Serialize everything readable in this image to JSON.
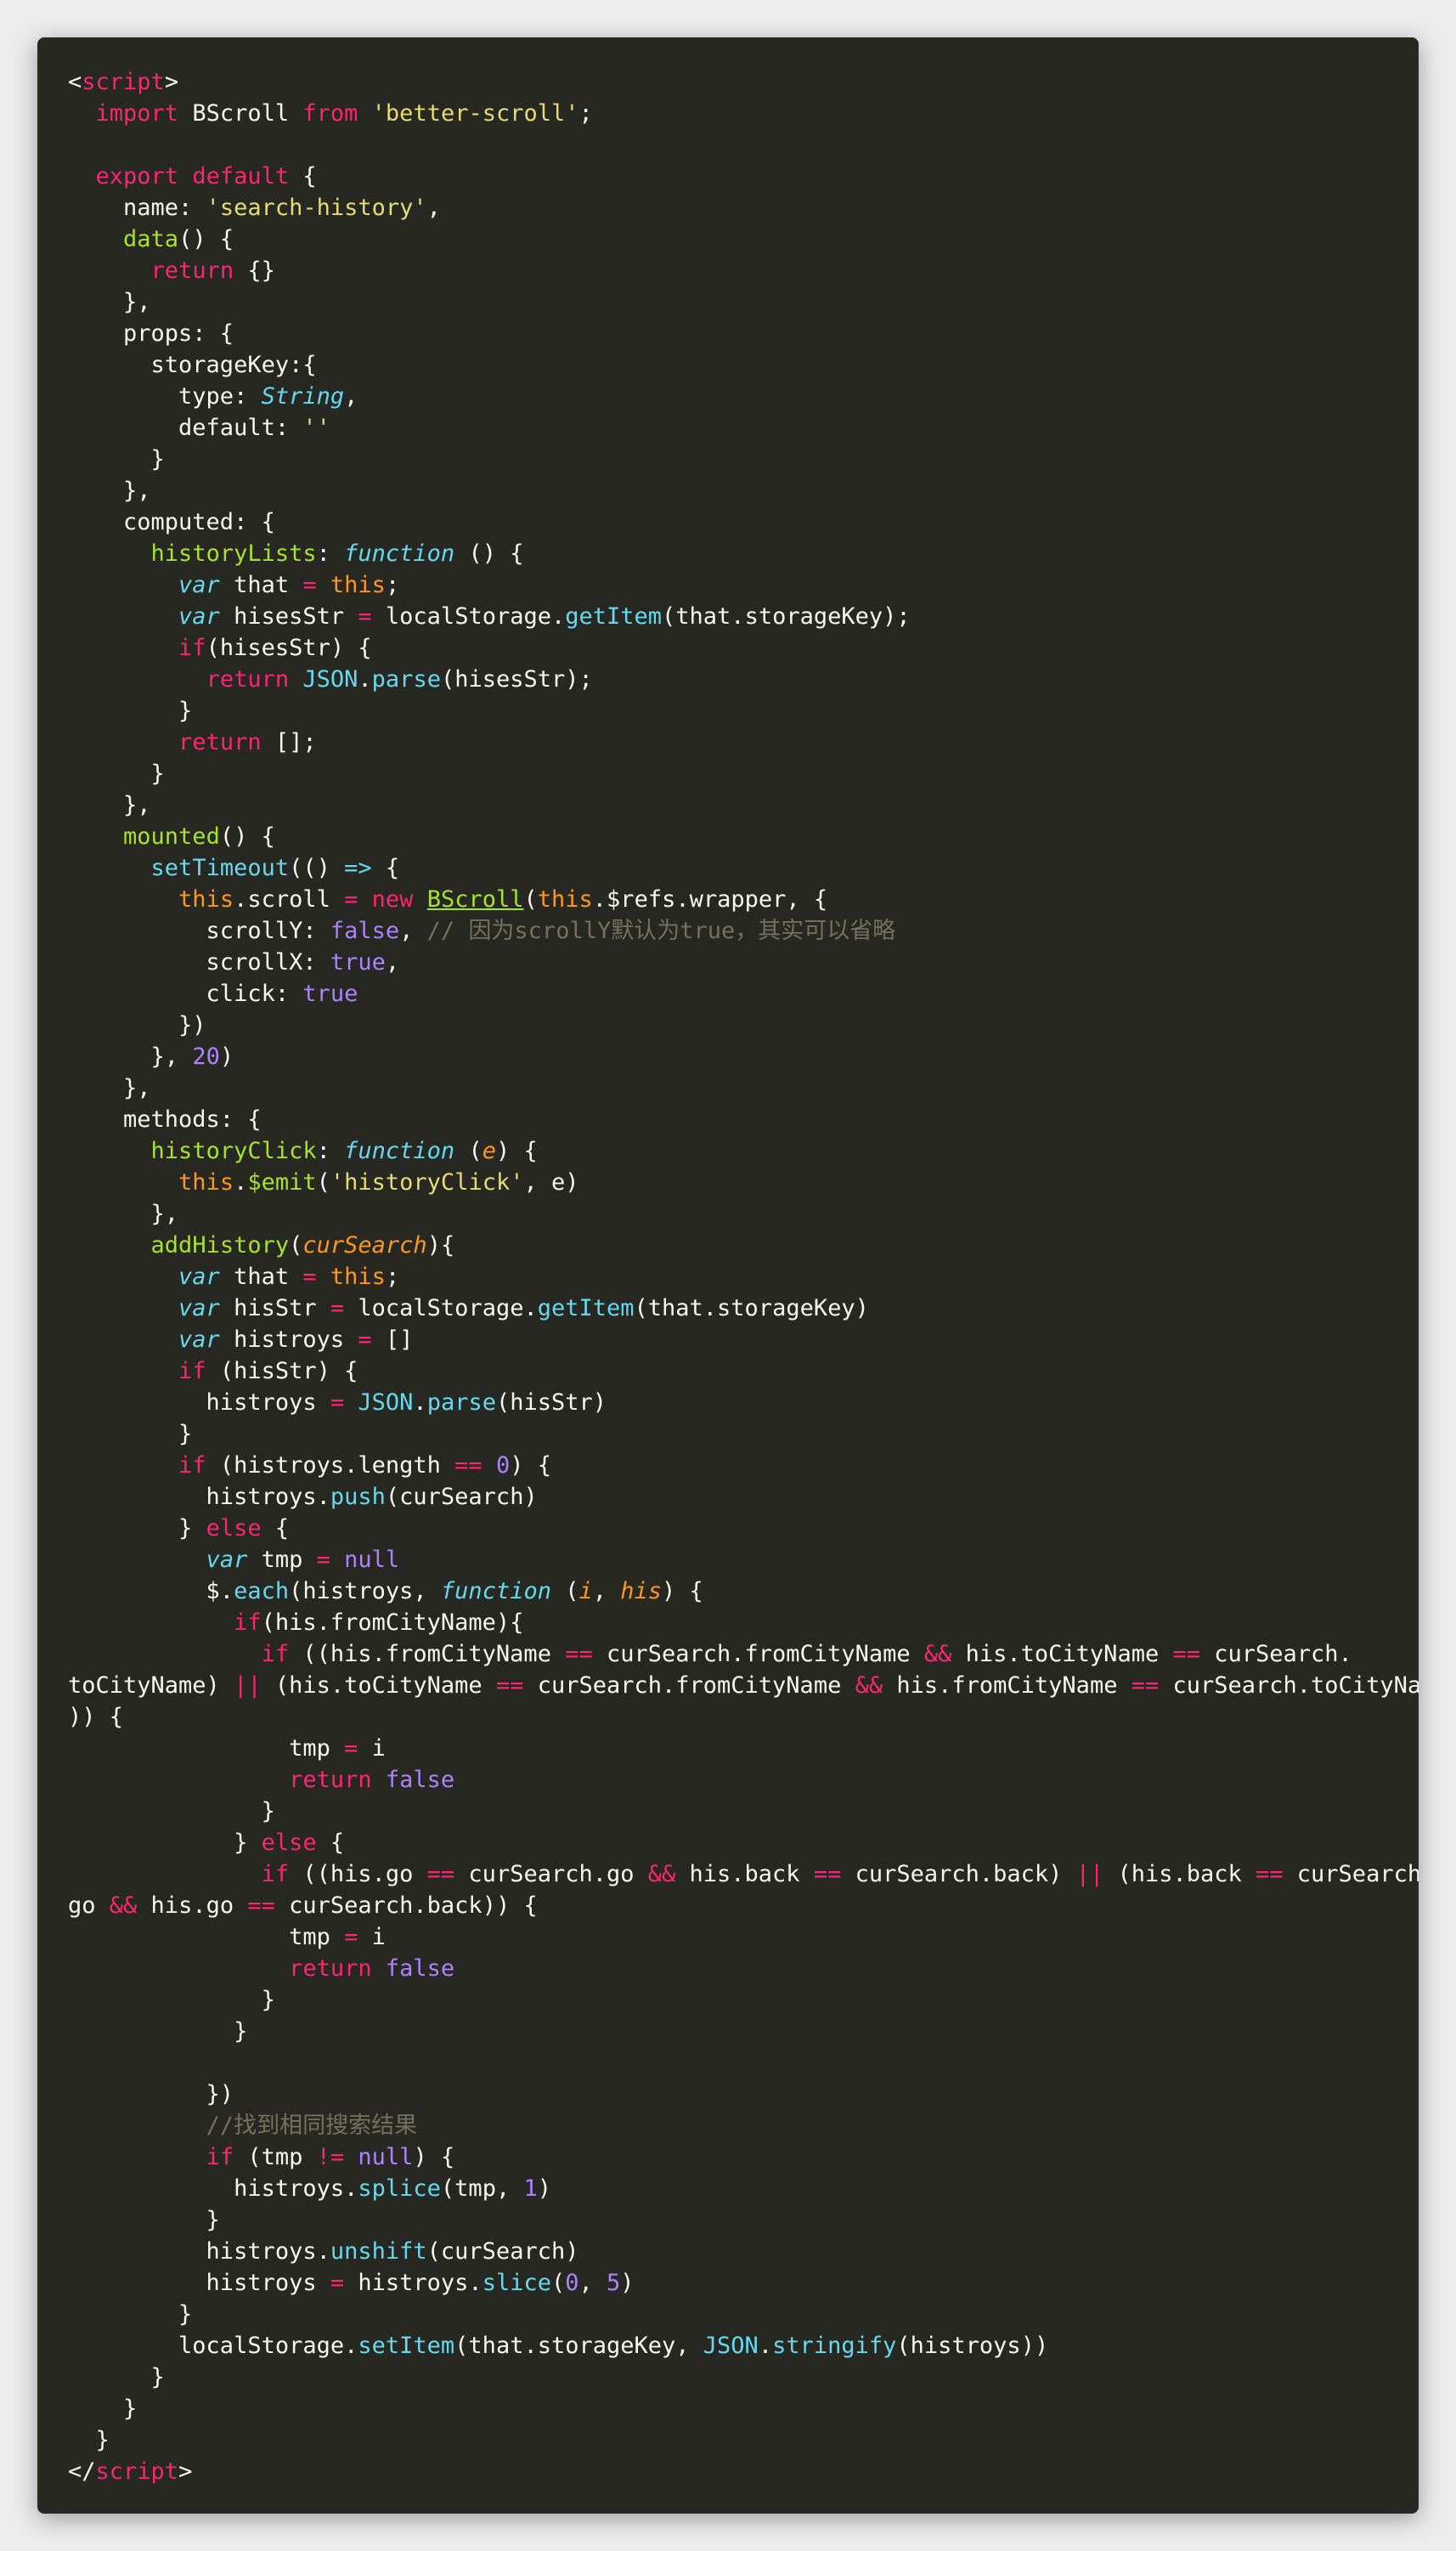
{
  "theme": {
    "background": "#ececec",
    "editor_bg": "#272822",
    "plain": "#f8f8f2",
    "keyword": "#f92672",
    "string": "#e6db74",
    "function": "#a6e22e",
    "builtin": "#66d9ef",
    "number": "#ae81ff",
    "parameter": "#fd971f",
    "comment": "#75715e"
  },
  "code": {
    "language": "vue",
    "lines": [
      [
        [
          "p",
          "<"
        ],
        [
          "k",
          "script"
        ],
        [
          "p",
          ">"
        ]
      ],
      [
        [
          "p",
          "  "
        ],
        [
          "k",
          "import"
        ],
        [
          "p",
          " BScroll "
        ],
        [
          "k",
          "from"
        ],
        [
          "p",
          " "
        ],
        [
          "s",
          "'better-scroll'"
        ],
        [
          "p",
          ";"
        ]
      ],
      [],
      [
        [
          "p",
          "  "
        ],
        [
          "k",
          "export"
        ],
        [
          "p",
          " "
        ],
        [
          "k",
          "default"
        ],
        [
          "p",
          " {"
        ]
      ],
      [
        [
          "p",
          "    name: "
        ],
        [
          "s",
          "'search-history'"
        ],
        [
          "p",
          ","
        ]
      ],
      [
        [
          "p",
          "    "
        ],
        [
          "f",
          "data"
        ],
        [
          "p",
          "() {"
        ]
      ],
      [
        [
          "p",
          "      "
        ],
        [
          "k",
          "return"
        ],
        [
          "p",
          " {}"
        ]
      ],
      [
        [
          "p",
          "    },"
        ]
      ],
      [
        [
          "p",
          "    props: {"
        ]
      ],
      [
        [
          "p",
          "      storageKey:{"
        ]
      ],
      [
        [
          "p",
          "        type: "
        ],
        [
          "i",
          "String"
        ],
        [
          "p",
          ","
        ]
      ],
      [
        [
          "p",
          "        default: "
        ],
        [
          "s",
          "''"
        ]
      ],
      [
        [
          "p",
          "      }"
        ]
      ],
      [
        [
          "p",
          "    },"
        ]
      ],
      [
        [
          "p",
          "    computed: {"
        ]
      ],
      [
        [
          "p",
          "      "
        ],
        [
          "f",
          "historyLists"
        ],
        [
          "p",
          ": "
        ],
        [
          "i",
          "function"
        ],
        [
          "p",
          " () {"
        ]
      ],
      [
        [
          "p",
          "        "
        ],
        [
          "i",
          "var"
        ],
        [
          "p",
          " that "
        ],
        [
          "k",
          "="
        ],
        [
          "p",
          " "
        ],
        [
          "t",
          "this"
        ],
        [
          "p",
          ";"
        ]
      ],
      [
        [
          "p",
          "        "
        ],
        [
          "i",
          "var"
        ],
        [
          "p",
          " hisesStr "
        ],
        [
          "k",
          "="
        ],
        [
          "p",
          " localStorage."
        ],
        [
          "b",
          "getItem"
        ],
        [
          "p",
          "(that.storageKey);"
        ]
      ],
      [
        [
          "p",
          "        "
        ],
        [
          "k",
          "if"
        ],
        [
          "p",
          "(hisesStr) {"
        ]
      ],
      [
        [
          "p",
          "          "
        ],
        [
          "k",
          "return"
        ],
        [
          "p",
          " "
        ],
        [
          "b",
          "JSON"
        ],
        [
          "p",
          "."
        ],
        [
          "b",
          "parse"
        ],
        [
          "p",
          "(hisesStr);"
        ]
      ],
      [
        [
          "p",
          "        }"
        ]
      ],
      [
        [
          "p",
          "        "
        ],
        [
          "k",
          "return"
        ],
        [
          "p",
          " [];"
        ]
      ],
      [
        [
          "p",
          "      }"
        ]
      ],
      [
        [
          "p",
          "    },"
        ]
      ],
      [
        [
          "p",
          "    "
        ],
        [
          "f",
          "mounted"
        ],
        [
          "p",
          "() {"
        ]
      ],
      [
        [
          "p",
          "      "
        ],
        [
          "b",
          "setTimeout"
        ],
        [
          "p",
          "(() "
        ],
        [
          "b",
          "=>"
        ],
        [
          "p",
          " {"
        ]
      ],
      [
        [
          "p",
          "        "
        ],
        [
          "t",
          "this"
        ],
        [
          "p",
          ".scroll "
        ],
        [
          "k",
          "="
        ],
        [
          "p",
          " "
        ],
        [
          "k",
          "new"
        ],
        [
          "p",
          " "
        ],
        [
          "u",
          "BScroll"
        ],
        [
          "p",
          "("
        ],
        [
          "t",
          "this"
        ],
        [
          "p",
          ".$refs.wrapper, {"
        ]
      ],
      [
        [
          "p",
          "          scrollY: "
        ],
        [
          "n",
          "false"
        ],
        [
          "p",
          ", "
        ],
        [
          "c",
          "// 因为scrollY默认为true，其实可以省略"
        ]
      ],
      [
        [
          "p",
          "          scrollX: "
        ],
        [
          "n",
          "true"
        ],
        [
          "p",
          ","
        ]
      ],
      [
        [
          "p",
          "          click: "
        ],
        [
          "n",
          "true"
        ]
      ],
      [
        [
          "p",
          "        })"
        ]
      ],
      [
        [
          "p",
          "      }, "
        ],
        [
          "n",
          "20"
        ],
        [
          "p",
          ")"
        ]
      ],
      [
        [
          "p",
          "    },"
        ]
      ],
      [
        [
          "p",
          "    methods: {"
        ]
      ],
      [
        [
          "p",
          "      "
        ],
        [
          "f",
          "historyClick"
        ],
        [
          "p",
          ": "
        ],
        [
          "i",
          "function"
        ],
        [
          "p",
          " ("
        ],
        [
          "a",
          "e"
        ],
        [
          "p",
          ") {"
        ]
      ],
      [
        [
          "p",
          "        "
        ],
        [
          "t",
          "this"
        ],
        [
          "p",
          "."
        ],
        [
          "f",
          "$emit"
        ],
        [
          "p",
          "("
        ],
        [
          "s",
          "'historyClick'"
        ],
        [
          "p",
          ", e)"
        ]
      ],
      [
        [
          "p",
          "      },"
        ]
      ],
      [
        [
          "p",
          "      "
        ],
        [
          "f",
          "addHistory"
        ],
        [
          "p",
          "("
        ],
        [
          "a",
          "curSearch"
        ],
        [
          "p",
          "){"
        ]
      ],
      [
        [
          "p",
          "        "
        ],
        [
          "i",
          "var"
        ],
        [
          "p",
          " that "
        ],
        [
          "k",
          "="
        ],
        [
          "p",
          " "
        ],
        [
          "t",
          "this"
        ],
        [
          "p",
          ";"
        ]
      ],
      [
        [
          "p",
          "        "
        ],
        [
          "i",
          "var"
        ],
        [
          "p",
          " hisStr "
        ],
        [
          "k",
          "="
        ],
        [
          "p",
          " localStorage."
        ],
        [
          "b",
          "getItem"
        ],
        [
          "p",
          "(that.storageKey)"
        ]
      ],
      [
        [
          "p",
          "        "
        ],
        [
          "i",
          "var"
        ],
        [
          "p",
          " histroys "
        ],
        [
          "k",
          "="
        ],
        [
          "p",
          " []"
        ]
      ],
      [
        [
          "p",
          "        "
        ],
        [
          "k",
          "if"
        ],
        [
          "p",
          " (hisStr) {"
        ]
      ],
      [
        [
          "p",
          "          histroys "
        ],
        [
          "k",
          "="
        ],
        [
          "p",
          " "
        ],
        [
          "b",
          "JSON"
        ],
        [
          "p",
          "."
        ],
        [
          "b",
          "parse"
        ],
        [
          "p",
          "(hisStr)"
        ]
      ],
      [
        [
          "p",
          "        }"
        ]
      ],
      [
        [
          "p",
          "        "
        ],
        [
          "k",
          "if"
        ],
        [
          "p",
          " (histroys.length "
        ],
        [
          "k",
          "=="
        ],
        [
          "p",
          " "
        ],
        [
          "n",
          "0"
        ],
        [
          "p",
          ") {"
        ]
      ],
      [
        [
          "p",
          "          histroys."
        ],
        [
          "b",
          "push"
        ],
        [
          "p",
          "(curSearch)"
        ]
      ],
      [
        [
          "p",
          "        } "
        ],
        [
          "k",
          "else"
        ],
        [
          "p",
          " {"
        ]
      ],
      [
        [
          "p",
          "          "
        ],
        [
          "i",
          "var"
        ],
        [
          "p",
          " tmp "
        ],
        [
          "k",
          "="
        ],
        [
          "p",
          " "
        ],
        [
          "n",
          "null"
        ]
      ],
      [
        [
          "p",
          "          $."
        ],
        [
          "b",
          "each"
        ],
        [
          "p",
          "(histroys, "
        ],
        [
          "i",
          "function"
        ],
        [
          "p",
          " ("
        ],
        [
          "a",
          "i"
        ],
        [
          "p",
          ", "
        ],
        [
          "a",
          "his"
        ],
        [
          "p",
          ") {"
        ]
      ],
      [
        [
          "p",
          "            "
        ],
        [
          "k",
          "if"
        ],
        [
          "p",
          "(his.fromCityName){"
        ]
      ],
      [
        [
          "p",
          "              "
        ],
        [
          "k",
          "if"
        ],
        [
          "p",
          " ((his.fromCityName "
        ],
        [
          "k",
          "=="
        ],
        [
          "p",
          " curSearch.fromCityName "
        ],
        [
          "k",
          "&&"
        ],
        [
          "p",
          " his.toCityName "
        ],
        [
          "k",
          "=="
        ],
        [
          "p",
          " curSearch."
        ]
      ],
      [
        [
          "p",
          "toCityName) "
        ],
        [
          "k",
          "||"
        ],
        [
          "p",
          " (his.toCityName "
        ],
        [
          "k",
          "=="
        ],
        [
          "p",
          " curSearch.fromCityName "
        ],
        [
          "k",
          "&&"
        ],
        [
          "p",
          " his.fromCityName "
        ],
        [
          "k",
          "=="
        ],
        [
          "p",
          " curSearch.toCityName"
        ]
      ],
      [
        [
          "p",
          ")) {"
        ]
      ],
      [
        [
          "p",
          "                tmp "
        ],
        [
          "k",
          "="
        ],
        [
          "p",
          " i"
        ]
      ],
      [
        [
          "p",
          "                "
        ],
        [
          "k",
          "return"
        ],
        [
          "p",
          " "
        ],
        [
          "n",
          "false"
        ]
      ],
      [
        [
          "p",
          "              }"
        ]
      ],
      [
        [
          "p",
          "            } "
        ],
        [
          "k",
          "else"
        ],
        [
          "p",
          " {"
        ]
      ],
      [
        [
          "p",
          "              "
        ],
        [
          "k",
          "if"
        ],
        [
          "p",
          " ((his.go "
        ],
        [
          "k",
          "=="
        ],
        [
          "p",
          " curSearch.go "
        ],
        [
          "k",
          "&&"
        ],
        [
          "p",
          " his.back "
        ],
        [
          "k",
          "=="
        ],
        [
          "p",
          " curSearch.back) "
        ],
        [
          "k",
          "||"
        ],
        [
          "p",
          " (his.back "
        ],
        [
          "k",
          "=="
        ],
        [
          "p",
          " curSearch."
        ]
      ],
      [
        [
          "p",
          "go "
        ],
        [
          "k",
          "&&"
        ],
        [
          "p",
          " his.go "
        ],
        [
          "k",
          "=="
        ],
        [
          "p",
          " curSearch.back)) {"
        ]
      ],
      [
        [
          "p",
          "                tmp "
        ],
        [
          "k",
          "="
        ],
        [
          "p",
          " i"
        ]
      ],
      [
        [
          "p",
          "                "
        ],
        [
          "k",
          "return"
        ],
        [
          "p",
          " "
        ],
        [
          "n",
          "false"
        ]
      ],
      [
        [
          "p",
          "              }"
        ]
      ],
      [
        [
          "p",
          "            }"
        ]
      ],
      [],
      [
        [
          "p",
          "          })"
        ]
      ],
      [
        [
          "p",
          "          "
        ],
        [
          "c",
          "//找到相同搜索结果"
        ]
      ],
      [
        [
          "p",
          "          "
        ],
        [
          "k",
          "if"
        ],
        [
          "p",
          " (tmp "
        ],
        [
          "k",
          "!="
        ],
        [
          "p",
          " "
        ],
        [
          "n",
          "null"
        ],
        [
          "p",
          ") {"
        ]
      ],
      [
        [
          "p",
          "            histroys."
        ],
        [
          "b",
          "splice"
        ],
        [
          "p",
          "(tmp, "
        ],
        [
          "n",
          "1"
        ],
        [
          "p",
          ")"
        ]
      ],
      [
        [
          "p",
          "          }"
        ]
      ],
      [
        [
          "p",
          "          histroys."
        ],
        [
          "b",
          "unshift"
        ],
        [
          "p",
          "(curSearch)"
        ]
      ],
      [
        [
          "p",
          "          histroys "
        ],
        [
          "k",
          "="
        ],
        [
          "p",
          " histroys."
        ],
        [
          "b",
          "slice"
        ],
        [
          "p",
          "("
        ],
        [
          "n",
          "0"
        ],
        [
          "p",
          ", "
        ],
        [
          "n",
          "5"
        ],
        [
          "p",
          ")"
        ]
      ],
      [
        [
          "p",
          "        }"
        ]
      ],
      [
        [
          "p",
          "        localStorage."
        ],
        [
          "b",
          "setItem"
        ],
        [
          "p",
          "(that.storageKey, "
        ],
        [
          "b",
          "JSON"
        ],
        [
          "p",
          "."
        ],
        [
          "b",
          "stringify"
        ],
        [
          "p",
          "(histroys))"
        ]
      ],
      [
        [
          "p",
          "      }"
        ]
      ],
      [
        [
          "p",
          "    }"
        ]
      ],
      [
        [
          "p",
          "  }"
        ]
      ],
      [
        [
          "p",
          "</"
        ],
        [
          "k",
          "script"
        ],
        [
          "p",
          ">"
        ]
      ]
    ]
  }
}
